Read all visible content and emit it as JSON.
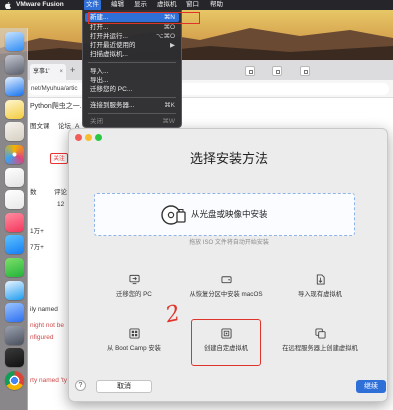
{
  "menubar": {
    "app_name": "VMware Fusion",
    "menus": [
      "文件",
      "编辑",
      "显示",
      "虚拟机",
      "窗口",
      "帮助"
    ]
  },
  "file_menu": {
    "items": [
      {
        "label": "新建...",
        "shortcut": "⌘N"
      },
      {
        "label": "打开...",
        "shortcut": "⌘O"
      },
      {
        "label": "打开并运行...",
        "shortcut": "⌥⌘O"
      },
      {
        "label": "打开最近使用的",
        "shortcut": "▶"
      },
      {
        "label": "扫描虚拟机...",
        "shortcut": ""
      },
      {
        "label": "导入...",
        "shortcut": ""
      },
      {
        "label": "导出...",
        "shortcut": ""
      },
      {
        "label": "迁移您的 PC...",
        "shortcut": ""
      },
      {
        "label": "连接到服务器...",
        "shortcut": "⌘K"
      },
      {
        "label": "关闭",
        "shortcut": "⌘W"
      }
    ]
  },
  "browser": {
    "tab_title": "享事1'",
    "tab_close": "×",
    "new_tab": "+",
    "address": "net/Myuhua/artic",
    "page_title": "Python爬虫之一...",
    "nav": [
      "图文课",
      "论坛",
      "A"
    ],
    "follow_button": "关注",
    "stats": {
      "label_a": "数",
      "label_b": "评论",
      "value_b": "12",
      "views": "1万+",
      "likes": "7万+"
    },
    "text_fragments": [
      "ily named",
      "night not be",
      "nfigured",
      "rty named 'ty"
    ]
  },
  "dialog": {
    "title": "选择安装方法",
    "disc_install_label": "从光盘或映像中安装",
    "drop_hint": "拖放 ISO 文件将自动开始安装",
    "options": [
      {
        "label": "迁移您的 PC",
        "icon": "migrate-pc-icon"
      },
      {
        "label": "从恢复分区中安装 macOS",
        "icon": "hard-drive-icon"
      },
      {
        "label": "导入现有虚拟机",
        "icon": "import-file-icon"
      },
      {
        "label": "从 Boot Camp 安装",
        "icon": "boot-camp-icon"
      },
      {
        "label": "创建自定虚拟机",
        "icon": "custom-vm-icon"
      },
      {
        "label": "在远程服务器上创建虚拟机",
        "icon": "remote-server-icon"
      }
    ],
    "help_label": "?",
    "cancel_label": "取消",
    "continue_label": "继续"
  },
  "annotation": {
    "label": "2",
    "color": "#e0342b"
  },
  "colors": {
    "accent": "#2f6fd8",
    "annotation_red": "#e0342b",
    "menu_bg": "#2c2c2f",
    "dialog_bg": "#ececec"
  },
  "dock": {
    "icons": [
      {
        "name": "finder-icon",
        "color": "#2f8df5",
        "color2": "#c6e2ff"
      },
      {
        "name": "launchpad-icon",
        "color": "#5d6270",
        "color2": "#c4c8d2"
      },
      {
        "name": "safari-icon",
        "color": "#1673ee",
        "color2": "#e6f1ff"
      },
      {
        "name": "notes-icon",
        "color": "#f3cc3f",
        "color2": "#fff6cf"
      },
      {
        "name": "dock-app-icon",
        "color": "#d6cfc2",
        "color2": "#f6f3ee"
      },
      {
        "name": "photos-icon",
        "color": "#f4b400",
        "color2": "#e0457b",
        "color3": "#3ba3f0"
      },
      {
        "name": "reminders-icon",
        "color": "#e2e2e2",
        "color2": "#ffffff"
      },
      {
        "name": "calendar-icon",
        "color": "#e8e8e8",
        "color2": "#ffffff"
      },
      {
        "name": "music-icon",
        "color": "#f5365c",
        "color2": "#ff8ea2"
      },
      {
        "name": "app-store-icon",
        "color": "#157ef5",
        "color2": "#5ec4ff"
      },
      {
        "name": "wechat-icon",
        "color": "#22b33a",
        "color2": "#7fe06a"
      },
      {
        "name": "qq-icon",
        "color": "#1f9cf0",
        "color2": "#e9f5ff"
      },
      {
        "name": "baidu-netdisk-icon",
        "color": "#2c6ff0",
        "color2": "#9cc6ff"
      },
      {
        "name": "dock-app-icon",
        "color": "#4a4f5c",
        "color2": "#9aa1b0"
      },
      {
        "name": "terminal-icon",
        "color": "#111111",
        "color2": "#3a3a3a"
      },
      {
        "name": "chrome-icon",
        "color": "#db4437",
        "color2": "#f4b400",
        "color3": "#0f9d58"
      }
    ]
  }
}
